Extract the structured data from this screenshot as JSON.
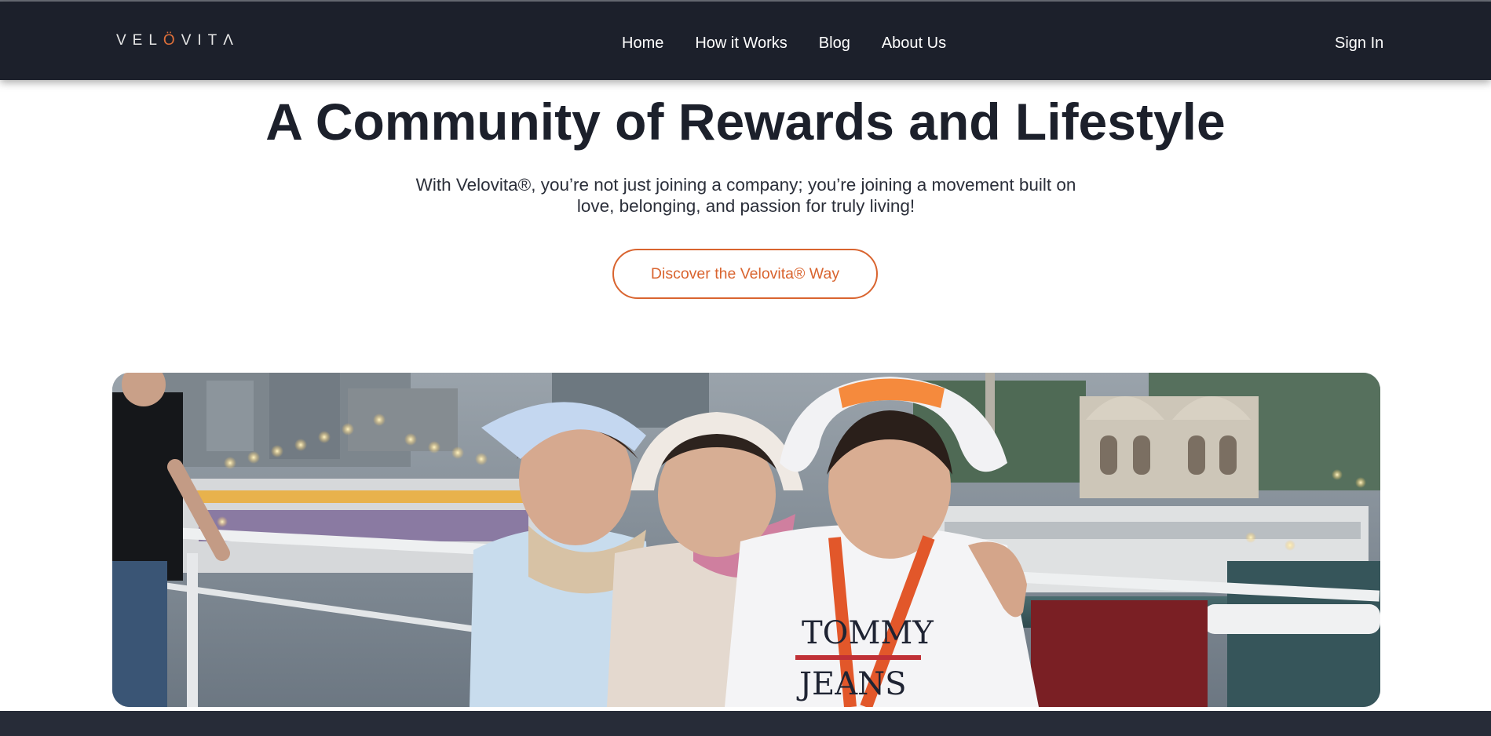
{
  "header": {
    "logo": {
      "text_before": "VEL",
      "accent_letter": "Ö",
      "text_after": "VITΛ"
    },
    "nav": [
      {
        "label": "Home"
      },
      {
        "label": "How it Works"
      },
      {
        "label": "Blog"
      },
      {
        "label": "About Us"
      }
    ],
    "sign_in": "Sign In"
  },
  "hero": {
    "title": "A Community of Rewards and Lifestyle",
    "subtitle": "With Velovita®, you’re not just joining a company; you’re joining a movement built on love, belonging, and passion for truly living!",
    "cta_label": "Discover the Velovita® Way"
  },
  "photo": {
    "shirt_text_1": "TOMMY",
    "shirt_text_2": "JEANS"
  },
  "colors": {
    "header_bg": "#1c202b",
    "accent": "#d9642f",
    "title_text": "#1c202b",
    "footer_bg": "#272c38"
  }
}
